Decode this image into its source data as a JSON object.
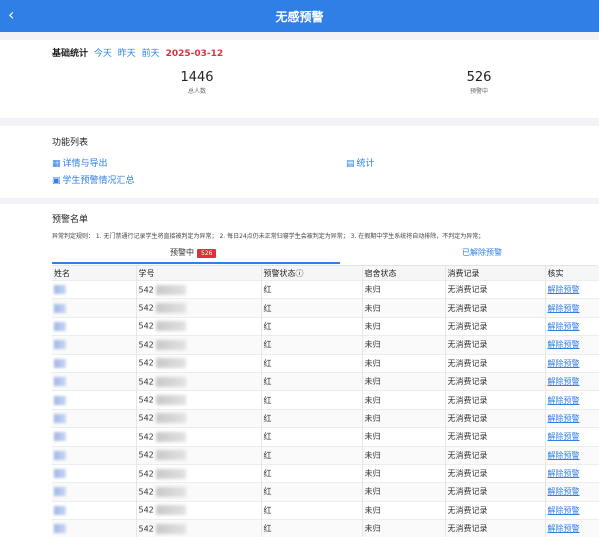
{
  "header": {
    "title": "无感预警",
    "back_icon": "chevron-left-icon"
  },
  "stats": {
    "title": "基础统计",
    "days": [
      "今天",
      "昨天",
      "前天"
    ],
    "date": "2025-03-12",
    "total": {
      "value": "1446",
      "label": "总人数"
    },
    "warning": {
      "value": "526",
      "label": "预警中"
    }
  },
  "functions": {
    "title": "功能列表",
    "items": [
      {
        "label": "详情与导出",
        "icon": "table-icon"
      },
      {
        "label": "统计",
        "icon": "chart-icon"
      },
      {
        "label": "学生预警情况汇总",
        "icon": "document-icon"
      }
    ]
  },
  "warning_list": {
    "title": "预警名单",
    "rule_text": "异常判定规则： 1. 无门禁通行记录学生将直接被判定为异常； 2. 每日24点仍未正常归寝学生会被判定为异常； 3. 在假期中学生系统将自动排除，不判定为异常；",
    "tabs": {
      "active_label": "预警中",
      "active_count": "526",
      "inactive_label": "已解除预警"
    },
    "columns": [
      "姓名",
      "学号",
      "预警状态ⓘ",
      "宿舍状态",
      "消费记录",
      "核实"
    ],
    "rows": [
      {
        "id_prefix": "542",
        "status": "红",
        "dorm": "未归",
        "consume": "无消费记录",
        "action": "解除预警"
      },
      {
        "id_prefix": "542",
        "status": "红",
        "dorm": "未归",
        "consume": "无消费记录",
        "action": "解除预警"
      },
      {
        "id_prefix": "542",
        "status": "红",
        "dorm": "未归",
        "consume": "无消费记录",
        "action": "解除预警"
      },
      {
        "id_prefix": "542",
        "status": "红",
        "dorm": "未归",
        "consume": "无消费记录",
        "action": "解除预警"
      },
      {
        "id_prefix": "542",
        "status": "红",
        "dorm": "未归",
        "consume": "无消费记录",
        "action": "解除预警"
      },
      {
        "id_prefix": "542",
        "status": "红",
        "dorm": "未归",
        "consume": "无消费记录",
        "action": "解除预警"
      },
      {
        "id_prefix": "542",
        "status": "红",
        "dorm": "未归",
        "consume": "无消费记录",
        "action": "解除预警"
      },
      {
        "id_prefix": "542",
        "status": "红",
        "dorm": "未归",
        "consume": "无消费记录",
        "action": "解除预警"
      },
      {
        "id_prefix": "542",
        "status": "红",
        "dorm": "未归",
        "consume": "无消费记录",
        "action": "解除预警"
      },
      {
        "id_prefix": "542",
        "status": "红",
        "dorm": "未归",
        "consume": "无消费记录",
        "action": "解除预警"
      },
      {
        "id_prefix": "542",
        "status": "红",
        "dorm": "未归",
        "consume": "无消费记录",
        "action": "解除预警"
      },
      {
        "id_prefix": "542",
        "status": "红",
        "dorm": "未归",
        "consume": "无消费记录",
        "action": "解除预警"
      },
      {
        "id_prefix": "542",
        "status": "红",
        "dorm": "未归",
        "consume": "无消费记录",
        "action": "解除预警"
      },
      {
        "id_prefix": "542",
        "status": "红",
        "dorm": "未归",
        "consume": "无消费记录",
        "action": "解除预警"
      }
    ]
  },
  "colors": {
    "primary": "#2f7fe6",
    "alert": "#e0303a"
  }
}
